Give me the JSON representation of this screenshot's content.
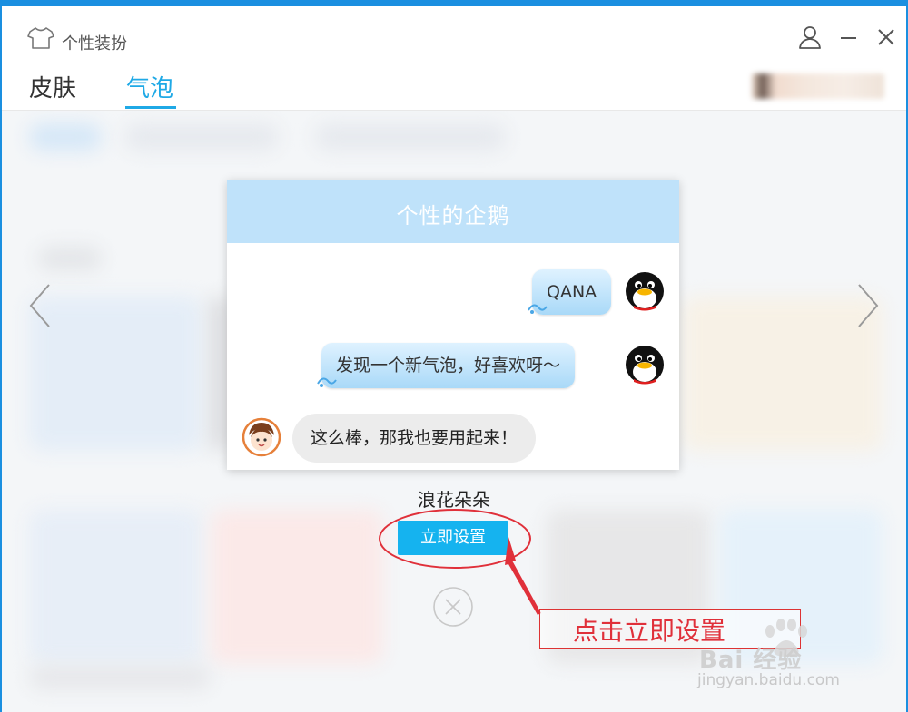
{
  "window": {
    "title": "个性装扮",
    "accent_color": "#1a8fe0",
    "controls": [
      "user-icon",
      "minimize-icon",
      "close-icon"
    ]
  },
  "tabs": [
    {
      "label": "皮肤",
      "active": false
    },
    {
      "label": "气泡",
      "active": true
    }
  ],
  "tab_active_color": "#1fa9e6",
  "preview": {
    "title": "个性的企鹅",
    "messages": [
      {
        "text": "QANA",
        "side": "right"
      },
      {
        "text": "发现一个新气泡，好喜欢呀～",
        "side": "right"
      },
      {
        "text": "这么棒，那我也要用起来！",
        "side": "left"
      }
    ]
  },
  "bubble_name": "浪花朵朵",
  "apply_label": "立即设置",
  "apply_color": "#15b3ef",
  "annotation": {
    "text": "点击立即设置",
    "color": "#e0303a"
  },
  "watermark": {
    "brand": "Bai 经验",
    "url": "jingyan.baidu.com"
  }
}
